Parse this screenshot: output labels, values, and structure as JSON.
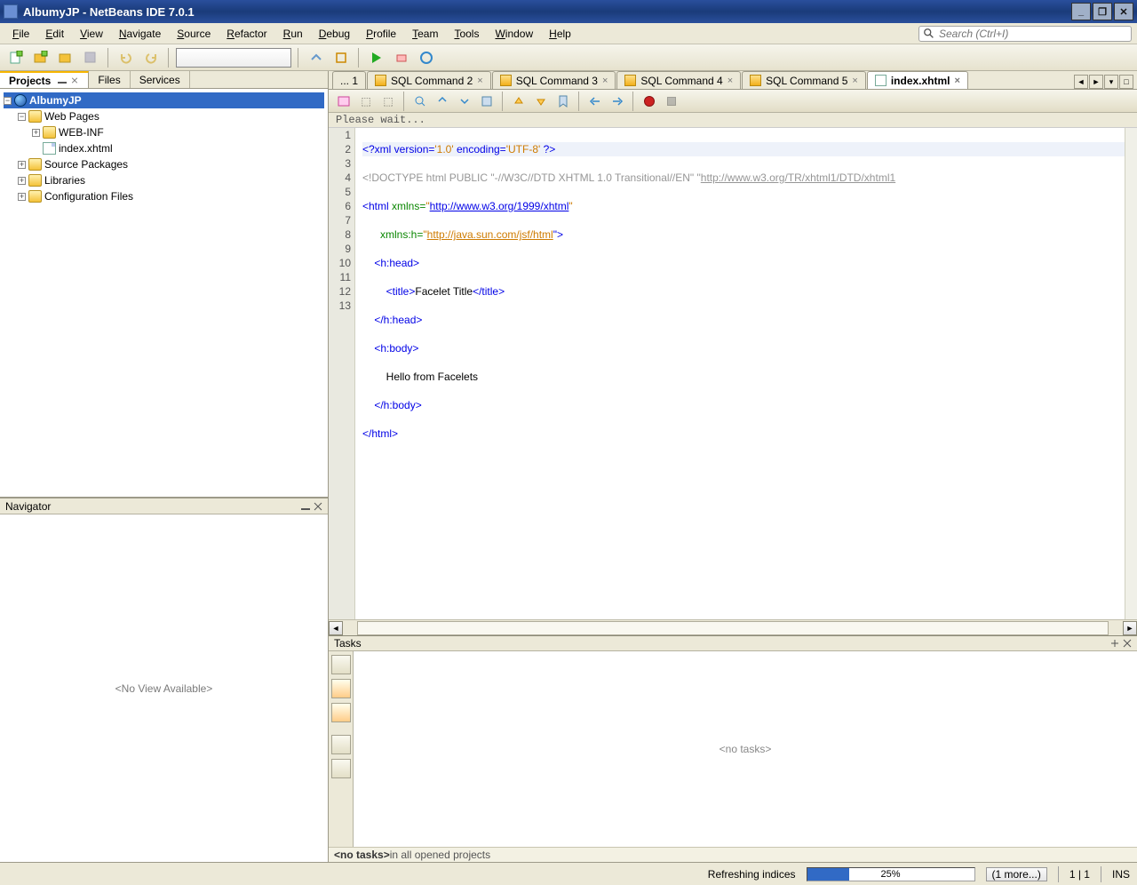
{
  "title": "AlbumyJP - NetBeans IDE 7.0.1",
  "menus": [
    {
      "label": "File",
      "u": "F"
    },
    {
      "label": "Edit",
      "u": "E"
    },
    {
      "label": "View",
      "u": "V"
    },
    {
      "label": "Navigate",
      "u": "N"
    },
    {
      "label": "Source",
      "u": "S"
    },
    {
      "label": "Refactor",
      "u": "R"
    },
    {
      "label": "Run",
      "u": "R"
    },
    {
      "label": "Debug",
      "u": "D"
    },
    {
      "label": "Profile",
      "u": "P"
    },
    {
      "label": "Team",
      "u": "T"
    },
    {
      "label": "Tools",
      "u": "T"
    },
    {
      "label": "Window",
      "u": "W"
    },
    {
      "label": "Help",
      "u": "H"
    }
  ],
  "search_placeholder": "Search (Ctrl+I)",
  "side_tabs": {
    "projects": "Projects",
    "files": "Files",
    "services": "Services"
  },
  "tree": {
    "root": "AlbumyJP",
    "n1": "Web Pages",
    "n2": "WEB-INF",
    "n3": "index.xhtml",
    "n4": "Source Packages",
    "n5": "Libraries",
    "n6": "Configuration Files"
  },
  "navigator": {
    "title": "Navigator",
    "empty": "<No View Available>"
  },
  "editor_tabs": {
    "first": "... 1",
    "t1": "SQL Command 2",
    "t2": "SQL Command 3",
    "t3": "SQL Command 4",
    "t4": "SQL Command 5",
    "t5": "index.xhtml",
    "close": "×"
  },
  "editor": {
    "please_wait": "Please wait...",
    "lines": {
      "l1_a": "<?xml version=",
      "l1_b": "'1.0'",
      "l1_c": " encoding=",
      "l1_d": "'UTF-8'",
      "l1_e": " ?>",
      "l2_a": "<!DOCTYPE html PUBLIC ",
      "l2_b": "\"-//W3C//DTD XHTML 1.0 Transitional//EN\"",
      "l2_c": " \"",
      "l2_d": "http://www.w3.org/TR/xhtml1/DTD/xhtml1",
      "l2_e": "",
      "l3_a": "<html ",
      "l3_b": "xmlns=",
      "l3_c": "\"",
      "l3_d": "http://www.w3.org/1999/xhtml",
      "l3_e": "\"",
      "l4_a": "      ",
      "l4_b": "xmlns:h=",
      "l4_c": "\"",
      "l4_d": "http://java.sun.com/jsf/html",
      "l4_e": "\">",
      "l5": "    <h:head>",
      "l6_a": "        <title>",
      "l6_b": "Facelet Title",
      "l6_c": "</title>",
      "l7": "    </h:head>",
      "l8": "    <h:body>",
      "l9": "        Hello from Facelets",
      "l10": "    </h:body>",
      "l11": "</html>"
    },
    "line_numbers": [
      "1",
      "2",
      "3",
      "4",
      "5",
      "6",
      "7",
      "8",
      "9",
      "10",
      "11",
      "12",
      "13"
    ]
  },
  "tasks": {
    "title": "Tasks",
    "empty": "<no tasks>",
    "footer_b": "<no tasks>",
    "footer_r": " in all opened projects"
  },
  "status": {
    "refreshing": "Refreshing indices",
    "progress_pct": "25%",
    "more": "(1 more...)",
    "pos": "1 | 1",
    "ins": "INS"
  }
}
